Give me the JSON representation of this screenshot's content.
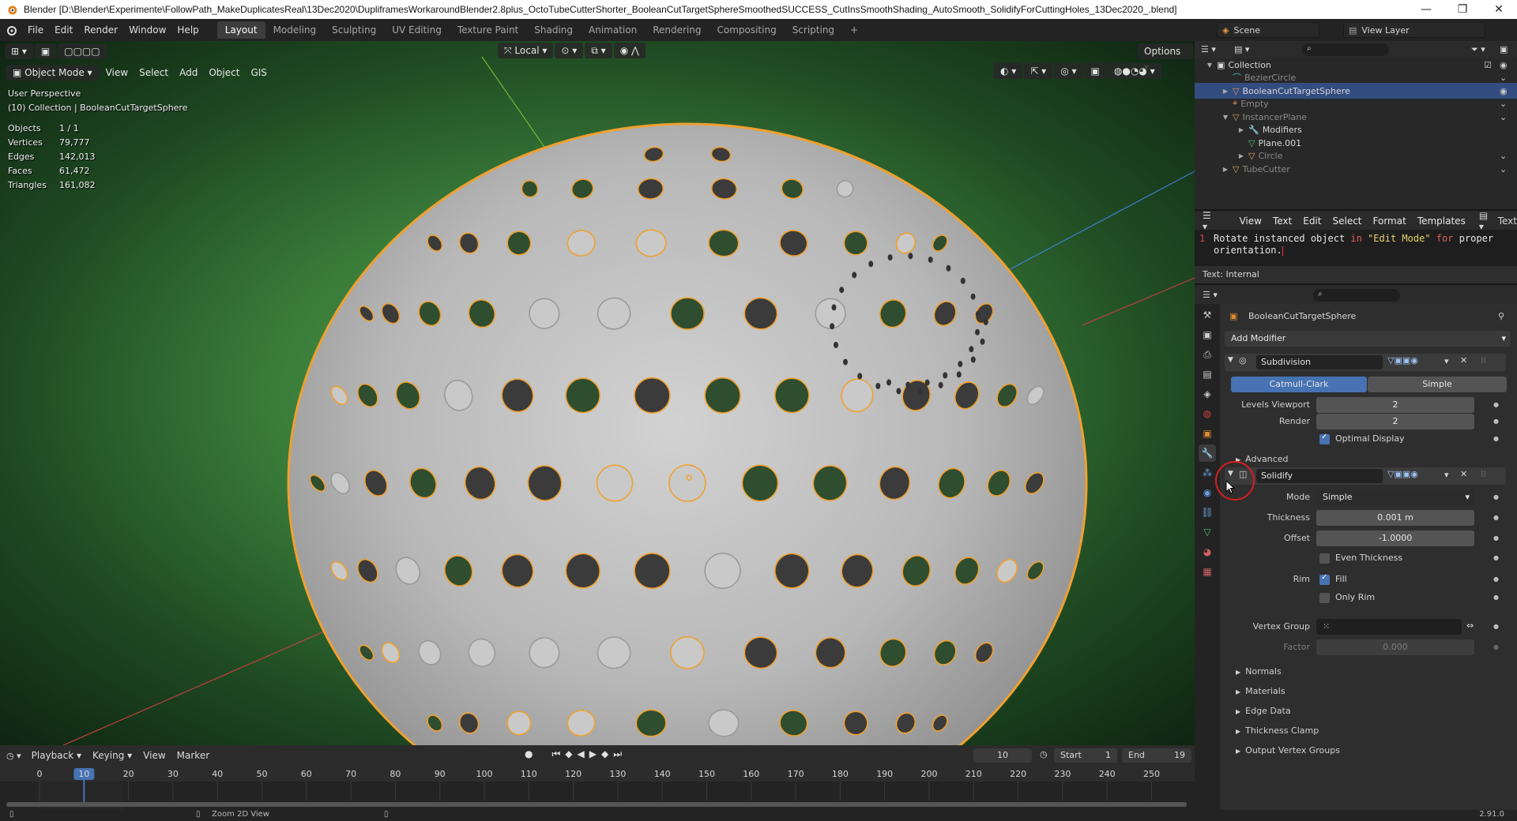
{
  "window": {
    "title": "Blender [D:\\Blender\\Experimente\\FollowPath_MakeDuplicatesReal\\13Dec2020\\DupliframesWorkaroundBlender2.8plus_OctoTubeCutterShorter_BooleanCutTargetSphereSmoothedSUCCESS_CutInsSmoothShading_AutoSmooth_SolidifyForCuttingHoles_13Dec2020_.blend]",
    "minimize": "—",
    "maximize": "❐",
    "close": "✕"
  },
  "menu": [
    "File",
    "Edit",
    "Render",
    "Window",
    "Help"
  ],
  "workspaces": [
    "Layout",
    "Modeling",
    "Sculpting",
    "UV Editing",
    "Texture Paint",
    "Shading",
    "Animation",
    "Rendering",
    "Compositing",
    "Scripting"
  ],
  "workspace_add": "+",
  "scene": {
    "name": "Scene",
    "view_layer": "View Layer"
  },
  "toolbar": {
    "orientation": "Local",
    "options": "Options"
  },
  "viewport": {
    "mode": "Object Mode",
    "menus": [
      "View",
      "Select",
      "Add",
      "Object",
      "GIS"
    ],
    "info_line1": "User Perspective",
    "info_line2": "(10) Collection | BooleanCutTargetSphere",
    "stats": [
      {
        "label": "Objects",
        "value": "1 / 1"
      },
      {
        "label": "Vertices",
        "value": "79,777"
      },
      {
        "label": "Edges",
        "value": "142,013"
      },
      {
        "label": "Faces",
        "value": "61,472"
      },
      {
        "label": "Triangles",
        "value": "161,082"
      }
    ],
    "colors": {
      "background_center": "#4b9b4b",
      "sphere": "#bdbdbd",
      "selection_outline": "#f0a030",
      "hole_fill": "#2f4d2f"
    }
  },
  "outliner": {
    "items": [
      {
        "label": "Collection",
        "level": 0,
        "dim": false,
        "selected": false
      },
      {
        "label": "BezierCircle",
        "level": 1,
        "dim": true,
        "selected": false
      },
      {
        "label": "BooleanCutTargetSphere",
        "level": 1,
        "dim": false,
        "selected": true
      },
      {
        "label": "Empty",
        "level": 1,
        "dim": true,
        "selected": false
      },
      {
        "label": "InstancerPlane",
        "level": 1,
        "dim": true,
        "selected": false
      },
      {
        "label": "Modifiers",
        "level": 2,
        "dim": false,
        "selected": false
      },
      {
        "label": "Plane.001",
        "level": 2,
        "dim": false,
        "selected": false
      },
      {
        "label": "Circle",
        "level": 2,
        "dim": true,
        "selected": false
      },
      {
        "label": "TubeCutter",
        "level": 1,
        "dim": true,
        "selected": false
      }
    ]
  },
  "text_editor": {
    "menus": [
      "View",
      "Text",
      "Edit",
      "Select",
      "Format",
      "Templates"
    ],
    "datablock": "Text",
    "line_number": "1",
    "line1_a": "Rotate instanced object ",
    "line1_in": "in",
    "line1_b": " ",
    "line1_str": "\"Edit Mode\"",
    "line1_c": " ",
    "line1_for": "for",
    "line1_d": " proper",
    "line2": "orientation.",
    "footer": "Text: Internal"
  },
  "properties": {
    "object_name": "BooleanCutTargetSphere",
    "add_modifier": "Add Modifier",
    "subdivision": {
      "name": "Subdivision",
      "mode_a": "Catmull-Clark",
      "mode_b": "Simple",
      "levels_viewport_label": "Levels Viewport",
      "levels_viewport": "2",
      "render_label": "Render",
      "render": "2",
      "optimal_display": "Optimal Display",
      "advanced": "Advanced"
    },
    "solidify": {
      "name": "Solidify",
      "mode_label": "Mode",
      "mode": "Simple",
      "thickness_label": "Thickness",
      "thickness": "0.001 m",
      "offset_label": "Offset",
      "offset": "-1.0000",
      "even_thickness": "Even Thickness",
      "rim_label": "Rim",
      "fill": "Fill",
      "only_rim": "Only Rim",
      "vertex_group_label": "Vertex Group",
      "factor_label": "Factor",
      "factor": "0.000",
      "subpanels": [
        "Normals",
        "Materials",
        "Edge Data",
        "Thickness Clamp",
        "Output Vertex Groups"
      ]
    }
  },
  "timeline": {
    "menus": [
      "Playback",
      "Keying",
      "View",
      "Marker"
    ],
    "current_frame": "10",
    "start_label": "Start",
    "start": "1",
    "end_label": "End",
    "end": "19",
    "ticks": [
      "0",
      "10",
      "20",
      "30",
      "40",
      "50",
      "60",
      "70",
      "80",
      "90",
      "100",
      "110",
      "120",
      "130",
      "140",
      "150",
      "160",
      "170",
      "180",
      "190",
      "200",
      "210",
      "220",
      "230",
      "240",
      "250"
    ]
  },
  "statusbar": {
    "hint": "Zoom 2D View",
    "version": "2.91.0"
  }
}
